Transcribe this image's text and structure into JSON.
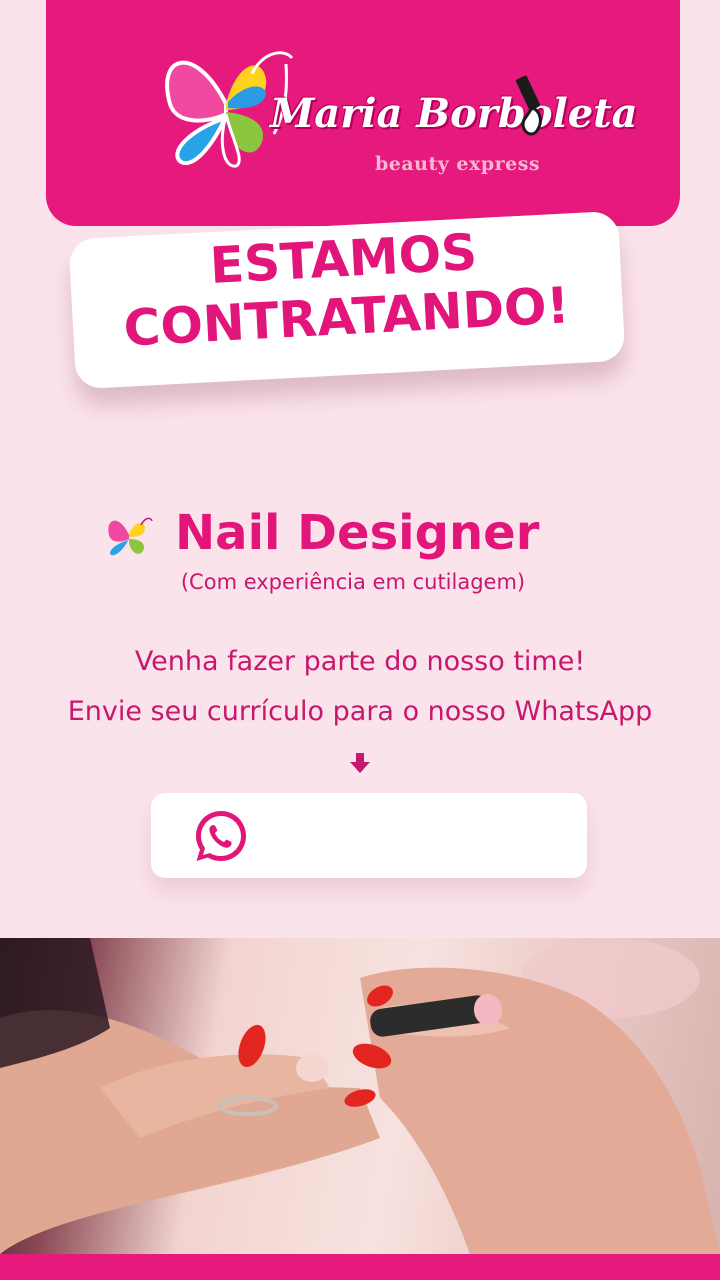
{
  "brand": {
    "name": "Maria Borboleta",
    "tagline": "beauty express"
  },
  "headline": "ESTAMOS CONTRATANDO!",
  "job": {
    "title": "Nail Designer",
    "requirement": "(Com experiência em cutilagem)"
  },
  "message": {
    "line1": "Venha fazer parte do nosso time!",
    "line2": "Envie seu currículo para o nosso WhatsApp"
  },
  "contact": {
    "icon": "whatsapp-icon",
    "value": ""
  },
  "colors": {
    "primary_pink": "#e6197d",
    "background": "#fbe3ec",
    "text_pink": "#c8176f"
  }
}
